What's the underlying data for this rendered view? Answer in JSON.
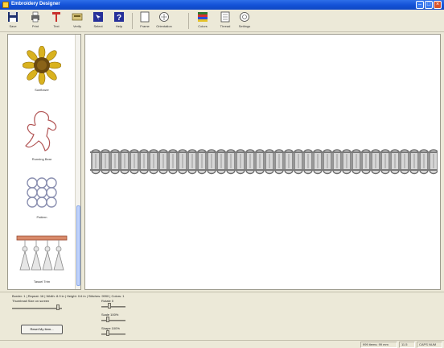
{
  "window": {
    "title": "Embroidery Designer"
  },
  "toolbar": {
    "items": [
      {
        "label": "Save"
      },
      {
        "label": "Print"
      },
      {
        "label": "Text"
      },
      {
        "label": "Verify"
      },
      {
        "label": "Select"
      },
      {
        "label": "Help"
      },
      {
        "label": "Frame"
      },
      {
        "label": "Orientation"
      },
      {
        "label": "Colors"
      },
      {
        "label": "Thread"
      },
      {
        "label": "Settings"
      }
    ]
  },
  "library": {
    "items": [
      {
        "caption": "Sunflower"
      },
      {
        "caption": "Running Bear"
      },
      {
        "caption": "Pattern"
      },
      {
        "caption": "Tassel Trim"
      }
    ]
  },
  "bottom": {
    "info": "Border: 1  |  Repeat: 16  |  Width: 8.9 in  |  Height: 0.6 in  |  Stitches: 9990  |  Colors: 1",
    "preview_label": "Thumbnail Size on screen",
    "sliders": [
      {
        "label": "Rotate 0"
      },
      {
        "label": "Scale 100%"
      },
      {
        "label": "Shape 100%"
      }
    ],
    "button": "Reset My Item..."
  },
  "status": {
    "panels": [
      "999 items: 99 mm",
      "11.5",
      "CAPS  NUM"
    ]
  },
  "colors": {
    "accent": "#1553d8",
    "design": "#7a7a7a"
  }
}
